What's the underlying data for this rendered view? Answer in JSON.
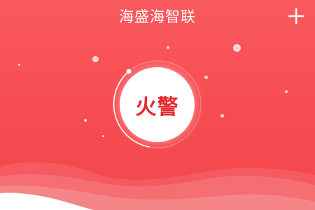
{
  "header": {
    "title": "海盛海智联",
    "add_icon": "plus-icon"
  },
  "main": {
    "alarm_button_label": "火警"
  },
  "colors": {
    "background": "#f64c51",
    "accent": "#e3292e",
    "foreground": "#ffffff"
  }
}
